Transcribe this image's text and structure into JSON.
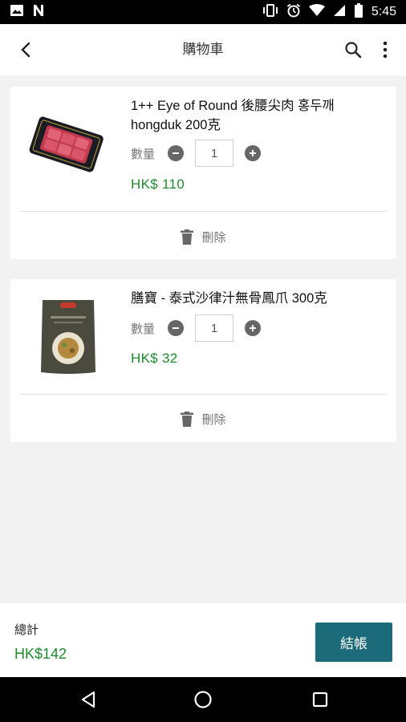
{
  "status_bar": {
    "time": "5:45",
    "left_icons": [
      "image-icon",
      "n-icon"
    ],
    "right_icons": [
      "vibrate-icon",
      "alarm-icon",
      "wifi-icon",
      "signal-icon",
      "battery-icon"
    ]
  },
  "app_bar": {
    "title": "購物車",
    "back_icon": "back-arrow-icon",
    "actions": [
      "search-icon",
      "more-vert-icon"
    ]
  },
  "cart": {
    "quantity_label": "數量",
    "delete_label": "刪除",
    "items": [
      {
        "title": "1++ Eye of Round 後腰尖肉 홍두깨 hongduk 200克",
        "quantity": "1",
        "price": "HK$ 110",
        "thumb_icon": "beef-tray-image"
      },
      {
        "title": "膳寶 - 泰式沙律汁無骨鳳爪 300克",
        "quantity": "1",
        "price": "HK$ 32",
        "thumb_icon": "food-pouch-image"
      }
    ]
  },
  "summary": {
    "total_label": "總計",
    "total_value": "HK$142",
    "checkout_label": "結帳"
  },
  "colors": {
    "accent": "#1c6b7a",
    "price_green": "#1f8a2c",
    "background": "#f2f2f2"
  }
}
